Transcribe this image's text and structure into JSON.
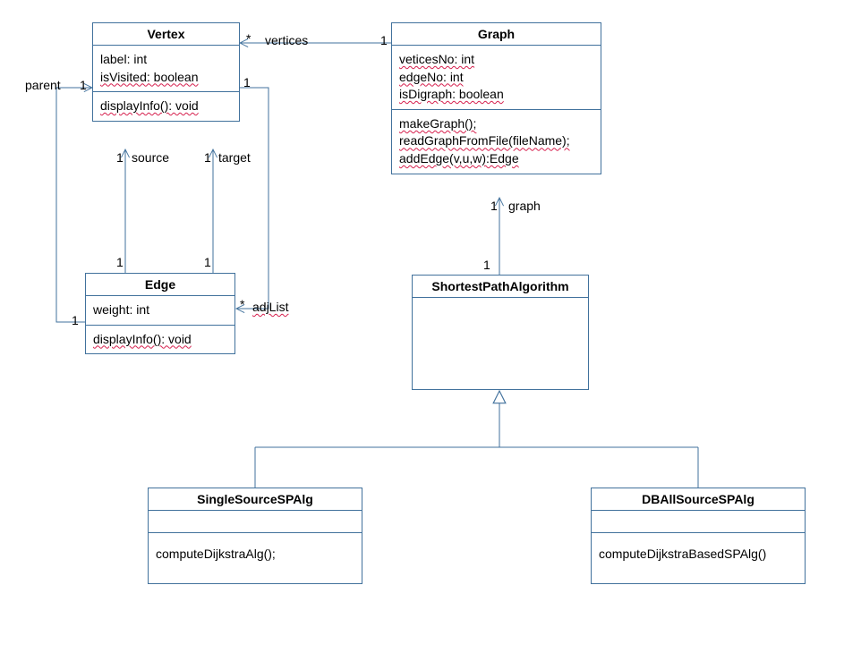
{
  "classes": {
    "vertex": {
      "name": "Vertex",
      "attrs": {
        "label": "label: int",
        "isVisited": "isVisited: boolean"
      },
      "ops": {
        "displayInfo": "displayInfo(): void"
      }
    },
    "graph": {
      "name": "Graph",
      "attrs": {
        "verticesNo": "veticesNo: int",
        "edgeNo": "edgeNo: int",
        "isDigraph": "isDigraph: boolean"
      },
      "ops": {
        "makeGraph": "makeGraph();",
        "readGraph": "readGraphFromFile(fileName);",
        "addEdge": "addEdge(v,u,w):Edge"
      }
    },
    "edge": {
      "name": "Edge",
      "attrs": {
        "weight": "weight: int"
      },
      "ops": {
        "displayInfo": "displayInfo(): void"
      }
    },
    "spa": {
      "name": "ShortestPathAlgorithm"
    },
    "single": {
      "name": "SingleSourceSPAlg",
      "ops": {
        "compute": "computeDijkstraAlg();"
      }
    },
    "dball": {
      "name": "DBAllSourceSPAlg",
      "ops": {
        "compute": "computeDijkstraBasedSPAlg()"
      }
    }
  },
  "assoc": {
    "vertices": {
      "role": "vertices",
      "near": "*",
      "far": "1"
    },
    "source": {
      "role": "source",
      "near": "1",
      "far": "1"
    },
    "target": {
      "role": "target",
      "near": "1",
      "far": "1"
    },
    "graph": {
      "role": "graph",
      "near": "1",
      "far": "1"
    },
    "adjList": {
      "role": "adjList",
      "near": "*",
      "far": "1"
    },
    "parent": {
      "role": "parent",
      "near": "1",
      "far": "1"
    }
  },
  "chart_data": {
    "type": "uml-class-diagram",
    "classes": [
      {
        "name": "Vertex",
        "attributes": [
          "label: int",
          "isVisited: boolean"
        ],
        "operations": [
          "displayInfo(): void"
        ]
      },
      {
        "name": "Graph",
        "attributes": [
          "veticesNo: int",
          "edgeNo: int",
          "isDigraph: boolean"
        ],
        "operations": [
          "makeGraph();",
          "readGraphFromFile(fileName);",
          "addEdge(v,u,w):Edge"
        ]
      },
      {
        "name": "Edge",
        "attributes": [
          "weight: int"
        ],
        "operations": [
          "displayInfo(): void"
        ]
      },
      {
        "name": "ShortestPathAlgorithm",
        "attributes": [],
        "operations": []
      },
      {
        "name": "SingleSourceSPAlg",
        "attributes": [],
        "operations": [
          "computeDijkstraAlg();"
        ]
      },
      {
        "name": "DBAllSourceSPAlg",
        "attributes": [],
        "operations": [
          "computeDijkstraBasedSPAlg()"
        ]
      }
    ],
    "associations": [
      {
        "from": "Graph",
        "to": "Vertex",
        "role": "vertices",
        "fromMult": "1",
        "toMult": "*",
        "navigable": "to"
      },
      {
        "from": "Edge",
        "to": "Vertex",
        "role": "source",
        "fromMult": "1",
        "toMult": "1",
        "navigable": "to"
      },
      {
        "from": "Edge",
        "to": "Vertex",
        "role": "target",
        "fromMult": "1",
        "toMult": "1",
        "navigable": "to"
      },
      {
        "from": "ShortestPathAlgorithm",
        "to": "Graph",
        "role": "graph",
        "fromMult": "1",
        "toMult": "1",
        "navigable": "to"
      },
      {
        "from": "Vertex",
        "to": "Edge",
        "role": "adjList",
        "fromMult": "1",
        "toMult": "*",
        "navigable": "to"
      },
      {
        "from": "Edge",
        "to": "Vertex",
        "role": "parent",
        "fromMult": "1",
        "toMult": "1",
        "navigable": "to"
      }
    ],
    "generalizations": [
      {
        "parent": "ShortestPathAlgorithm",
        "child": "SingleSourceSPAlg"
      },
      {
        "parent": "ShortestPathAlgorithm",
        "child": "DBAllSourceSPAlg"
      }
    ]
  }
}
